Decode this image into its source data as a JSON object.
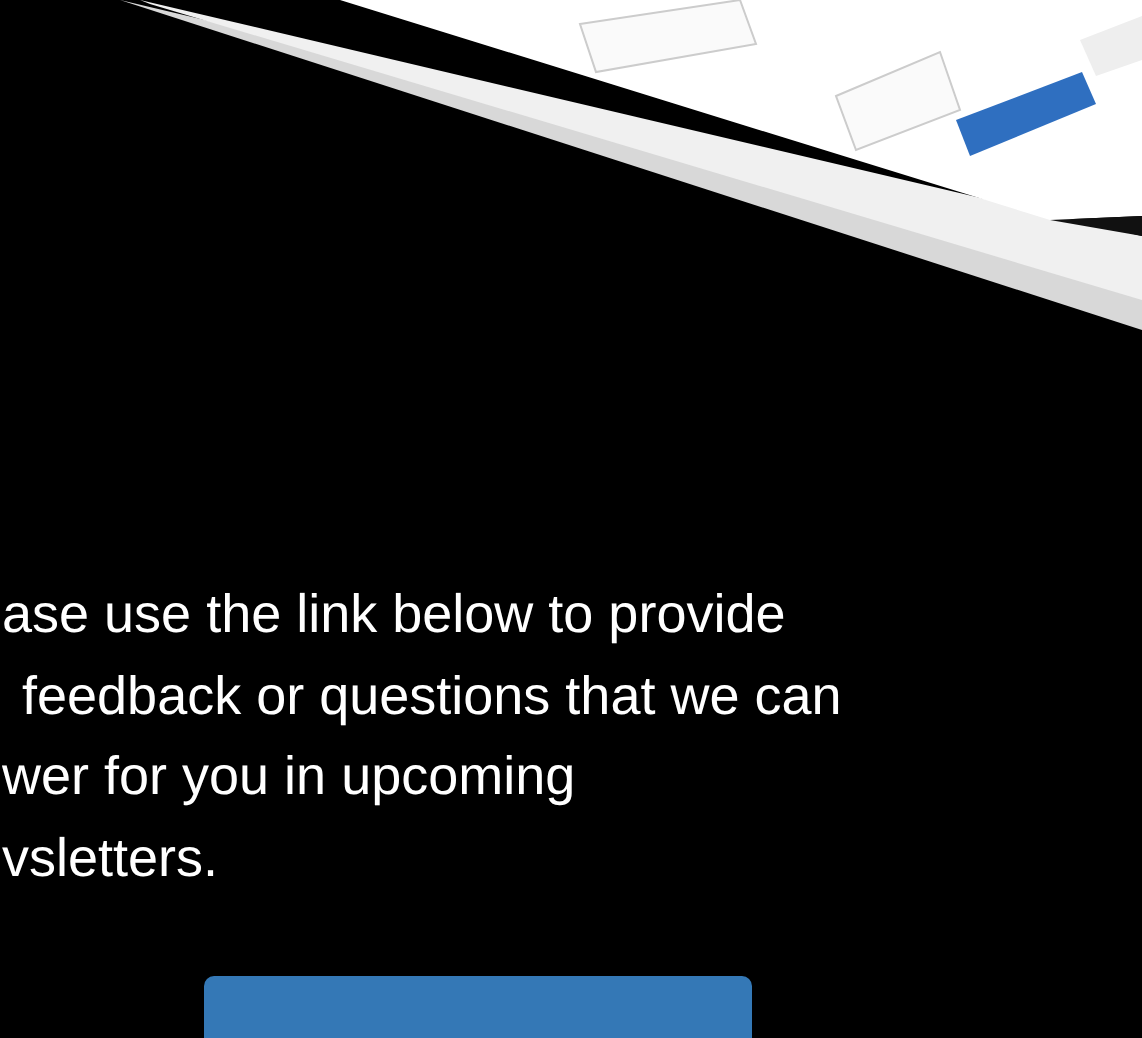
{
  "paragraph_lines": [
    "ase use the link below to provide",
    "feedback or questions that we can",
    "wer for you in upcoming",
    "vsletters."
  ],
  "button": {
    "kind": "link-button"
  }
}
